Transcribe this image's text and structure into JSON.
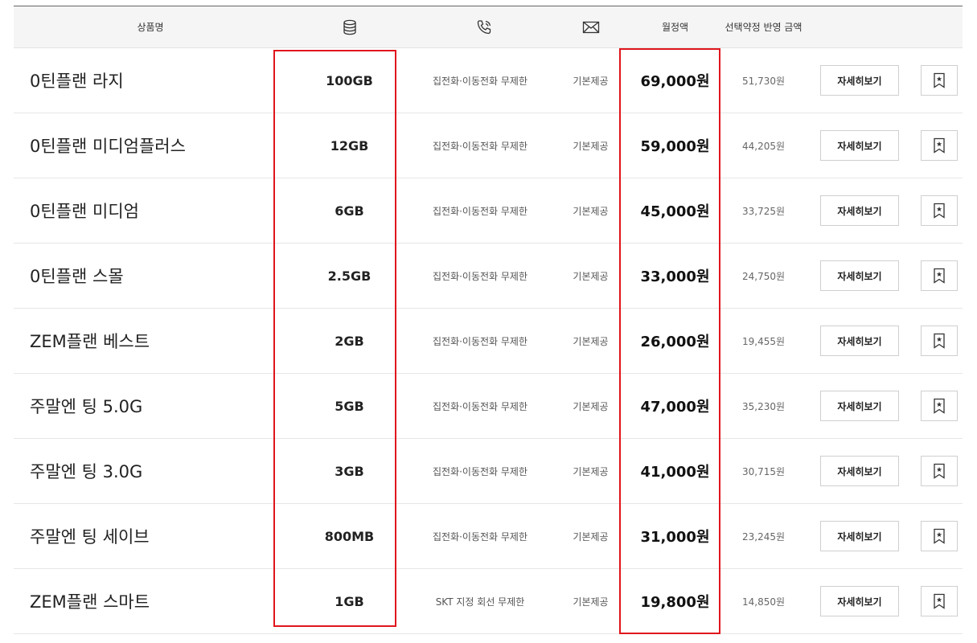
{
  "header": {
    "name": "상품명",
    "data_icon": "database-icon",
    "voice_icon": "phone-icon",
    "sms_icon": "mail-icon",
    "price": "월정액",
    "discount": "선택약정 반영 금액"
  },
  "rows": [
    {
      "name": "0틴플랜 라지",
      "data": "100GB",
      "voice": "집전화·이동전화 무제한",
      "sms": "기본제공",
      "price": "69,000원",
      "discount": "51,730원",
      "detail": "자세히보기"
    },
    {
      "name": "0틴플랜 미디엄플러스",
      "data": "12GB",
      "voice": "집전화·이동전화 무제한",
      "sms": "기본제공",
      "price": "59,000원",
      "discount": "44,205원",
      "detail": "자세히보기"
    },
    {
      "name": "0틴플랜 미디엄",
      "data": "6GB",
      "voice": "집전화·이동전화 무제한",
      "sms": "기본제공",
      "price": "45,000원",
      "discount": "33,725원",
      "detail": "자세히보기"
    },
    {
      "name": "0틴플랜 스몰",
      "data": "2.5GB",
      "voice": "집전화·이동전화 무제한",
      "sms": "기본제공",
      "price": "33,000원",
      "discount": "24,750원",
      "detail": "자세히보기"
    },
    {
      "name": "ZEM플랜 베스트",
      "data": "2GB",
      "voice": "집전화·이동전화 무제한",
      "sms": "기본제공",
      "price": "26,000원",
      "discount": "19,455원",
      "detail": "자세히보기"
    },
    {
      "name": "주말엔 팅 5.0G",
      "data": "5GB",
      "voice": "집전화·이동전화 무제한",
      "sms": "기본제공",
      "price": "47,000원",
      "discount": "35,230원",
      "detail": "자세히보기"
    },
    {
      "name": "주말엔 팅 3.0G",
      "data": "3GB",
      "voice": "집전화·이동전화 무제한",
      "sms": "기본제공",
      "price": "41,000원",
      "discount": "30,715원",
      "detail": "자세히보기"
    },
    {
      "name": "주말엔 팅 세이브",
      "data": "800MB",
      "voice": "집전화·이동전화 무제한",
      "sms": "기본제공",
      "price": "31,000원",
      "discount": "23,245원",
      "detail": "자세히보기"
    },
    {
      "name": "ZEM플랜 스마트",
      "data": "1GB",
      "voice": "SKT 지정 회선 무제한",
      "sms": "기본제공",
      "price": "19,800원",
      "discount": "14,850원",
      "detail": "자세히보기"
    }
  ],
  "bookmark_icon": "bookmark-icon",
  "highlight_color": "#e0151d"
}
